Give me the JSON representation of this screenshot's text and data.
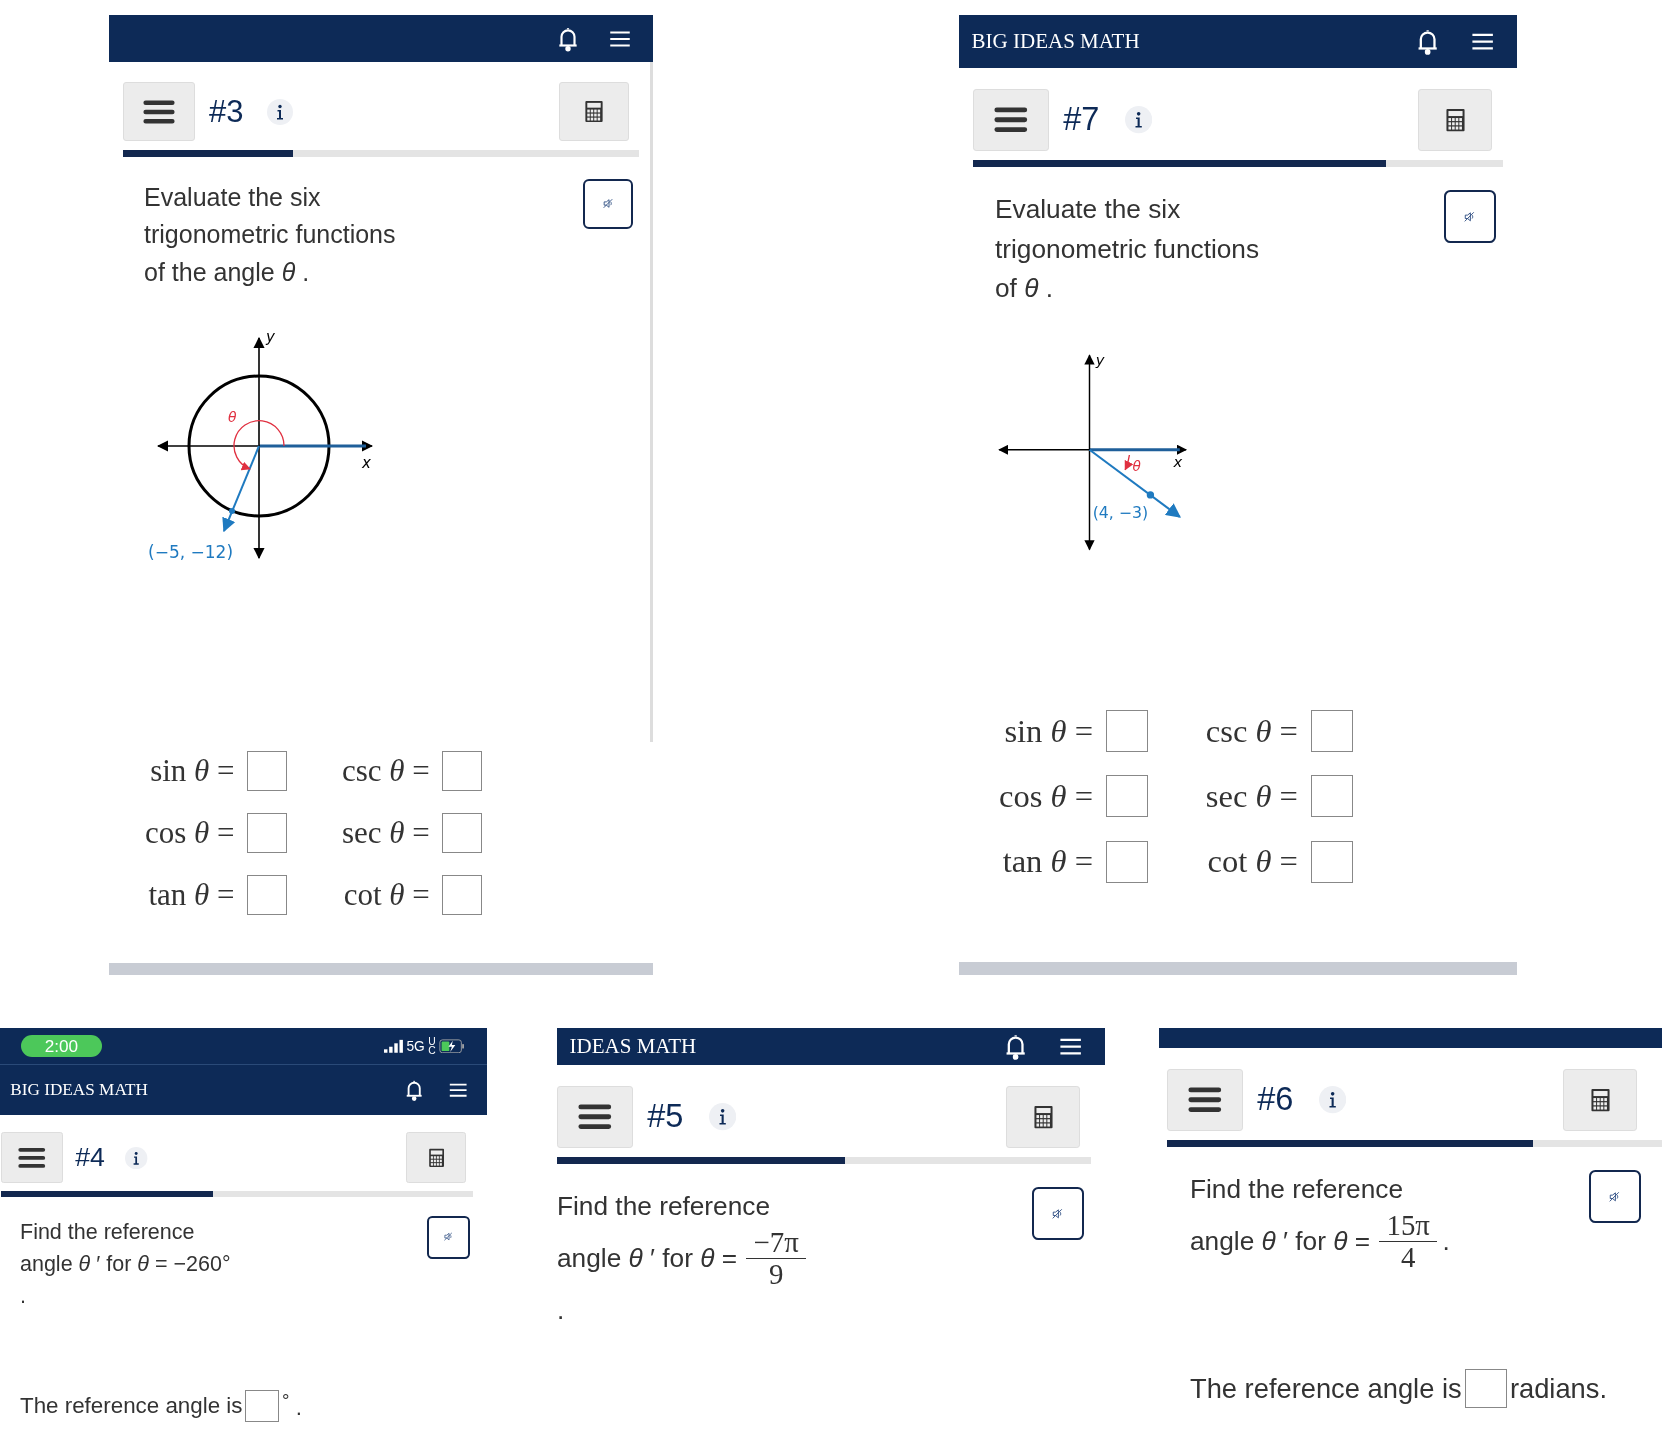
{
  "panels": [
    {
      "header": {
        "show_icons": true
      },
      "toolbar": {
        "number": "#3"
      },
      "progress": {
        "level": 0.33
      },
      "prompt": [
        {
          "text": "Evaluate the six"
        },
        {
          "text": "trigonometric functions"
        },
        {
          "text": "of the angle *θ* ."
        }
      ],
      "figure": {
        "kind": "unit-circle",
        "y_label": "y",
        "x_label": "x",
        "angle_label": "θ",
        "point_label": "(−5, −12)"
      },
      "functions": [
        {
          "label": "sin *θ* =",
          "pair": "csc *θ* ="
        },
        {
          "label": "cos *θ* =",
          "pair": "sec *θ* ="
        },
        {
          "label": "tan *θ* =",
          "pair": "cot *θ* ="
        }
      ]
    },
    {
      "header": {
        "title": "BIG IDEAS MATH",
        "show_icons": true
      },
      "toolbar": {
        "number": "#7"
      },
      "progress": {
        "level": 0.78
      },
      "prompt": [
        {
          "text": "Evaluate the six"
        },
        {
          "text": "trigonometric functions"
        },
        {
          "text": "of *θ* ."
        }
      ],
      "figure": {
        "kind": "axes",
        "y_label": "y",
        "x_label": "x",
        "angle_label": "θ",
        "point_label": "(4, −3)"
      },
      "functions": [
        {
          "label": "sin *θ* =",
          "pair": "csc *θ* ="
        },
        {
          "label": "cos *θ* =",
          "pair": "sec *θ* ="
        },
        {
          "label": "tan *θ* =",
          "pair": "cot *θ* ="
        }
      ]
    },
    {
      "status_bar": {
        "time": "2:00",
        "network": "5G",
        "network_sub": "UC"
      },
      "header": {
        "title": "BIG IDEAS MATH",
        "show_icons": true
      },
      "toolbar": {
        "number": "#4"
      },
      "progress": {
        "level": 0.45
      },
      "prompt": [
        {
          "text": "Find the reference"
        },
        {
          "text": "angle *θ* ′  for *θ* = −260°"
        },
        {
          "text": "."
        }
      ],
      "answer": {
        "before": "The reference angle is",
        "after": "$^{°}$ ."
      }
    },
    {
      "header": {
        "title": "IDEAS MATH",
        "show_icons": true
      },
      "toolbar": {
        "number": "#5"
      },
      "progress": {
        "level": 0.54
      },
      "prompt": [
        {
          "text": "Find the reference"
        },
        {
          "text": "angle *θ* ′  for *θ* =",
          "numerator": "−7π",
          "denominator": "9"
        },
        {
          "text": "."
        }
      ]
    },
    {
      "header": {
        "show_icons": false
      },
      "toolbar": {
        "number": "#6"
      },
      "progress": {
        "level": 0.74
      },
      "prompt": [
        {
          "text": "Find the reference"
        },
        {
          "text": "angle *θ* ′  for *θ* =",
          "numerator": "15π",
          "denominator": "4",
          "after": "."
        }
      ],
      "answer": {
        "before": "The reference angle is",
        "after": "radians."
      }
    }
  ]
}
